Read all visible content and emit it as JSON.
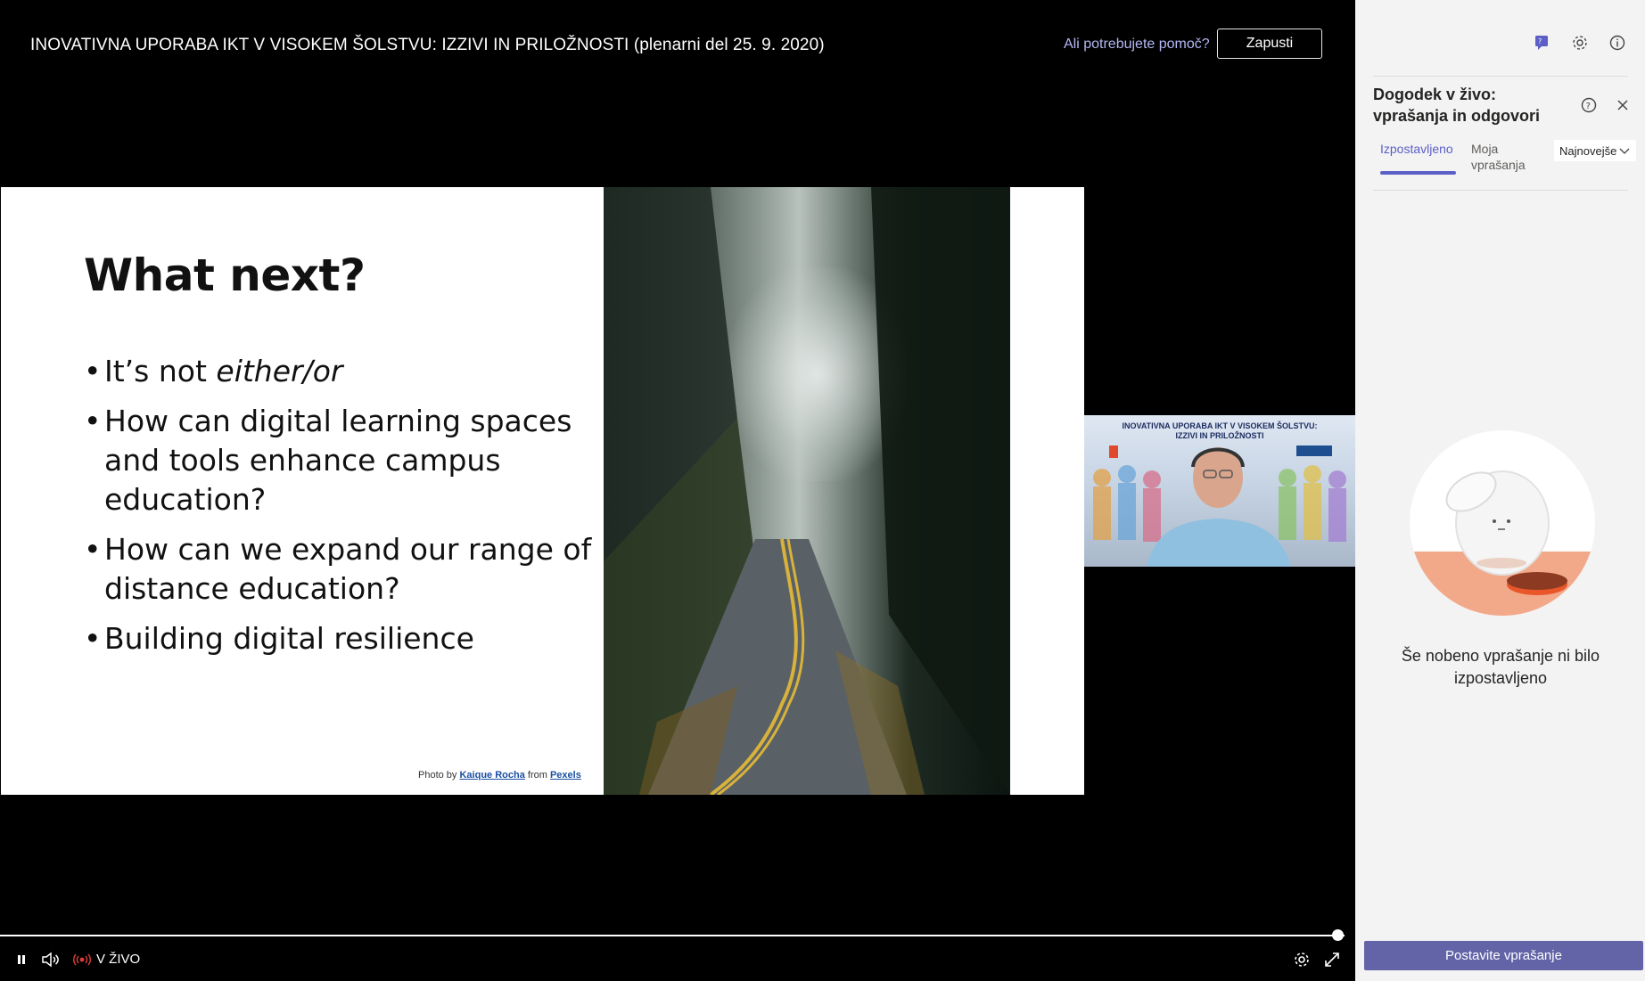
{
  "header": {
    "event_title": "INOVATIVNA UPORABA IKT V VISOKEM ŠOLSTVU: IZZIVI IN PRILOŽNOSTI (plenarni del 25. 9. 2020)",
    "help_link": "Ali potrebujete pomoč?",
    "leave_label": "Zapusti"
  },
  "slide": {
    "title": "What next?",
    "bullets": [
      {
        "text_a": "It’s not ",
        "emph": "either/or"
      },
      {
        "text": "How can digital learning spaces and tools enhance campus education?"
      },
      {
        "text": "How can we expand our range of distance education?"
      },
      {
        "text": "Building digital resilience"
      }
    ],
    "credit_prefix": "Photo by ",
    "credit_author": "Kaique Rocha",
    "credit_mid": " from ",
    "credit_source": "Pexels"
  },
  "speaker": {
    "banner_line1": "INOVATIVNA UPORABA IKT V VISOKEM ŠOLSTVU:",
    "banner_line2": "IZZIVI IN PRILOŽNOSTI"
  },
  "controls": {
    "live_label": "V ŽIVO",
    "icons": [
      "pause-icon",
      "volume-icon",
      "live-indicator-icon",
      "settings-icon",
      "fullscreen-icon"
    ],
    "live_color": "#e03b3b"
  },
  "side_panel": {
    "title": "Dogodek v živo: vprašanja in odgovori",
    "tabs": [
      {
        "label": "Izpostavljeno",
        "active": true
      },
      {
        "label": "Moja vprašanja",
        "active": false
      }
    ],
    "sort_value": "Najnovejše",
    "empty_message": "Še nobeno vprašanje ni bilo izpostavljeno",
    "ask_button": "Postavite vprašanje",
    "accent_color": "#6264a7",
    "top_icons": [
      "qna-icon",
      "gear-icon",
      "info-icon"
    ]
  }
}
